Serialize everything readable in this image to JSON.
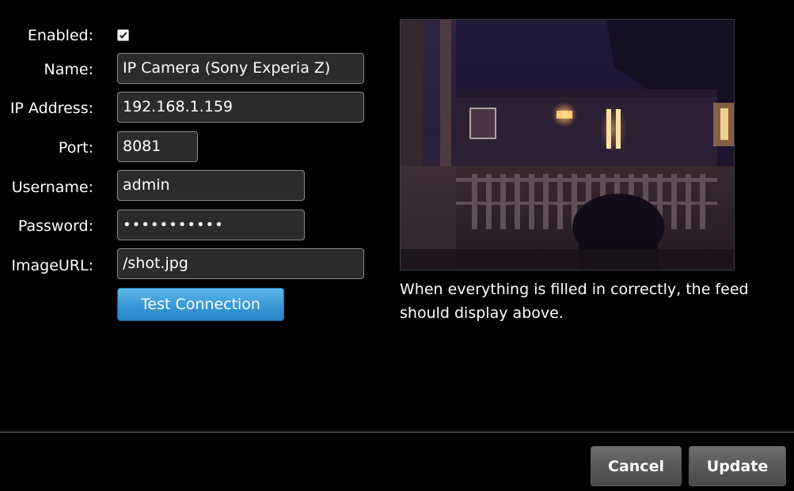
{
  "form": {
    "enabled": {
      "label": "Enabled:",
      "checked": true
    },
    "name": {
      "label": "Name:",
      "value": "IP Camera (Sony Experia Z)"
    },
    "ip_address": {
      "label": "IP Address:",
      "value": "192.168.1.159"
    },
    "port": {
      "label": "Port:",
      "value": "8081"
    },
    "username": {
      "label": "Username:",
      "value": "admin"
    },
    "password": {
      "label": "Password:",
      "value": "•••••••••••"
    },
    "image_url": {
      "label": "ImageURL:",
      "value": "/shot.jpg"
    },
    "test_button_label": "Test Connection"
  },
  "preview": {
    "caption": "When everything is filled in correctly, the feed should display above."
  },
  "footer": {
    "cancel_label": "Cancel",
    "update_label": "Update"
  },
  "colors": {
    "background": "#000000",
    "field_background": "#2b2b2b",
    "accent_button": "#3a9ad8",
    "action_button": "#5c5c5c"
  }
}
